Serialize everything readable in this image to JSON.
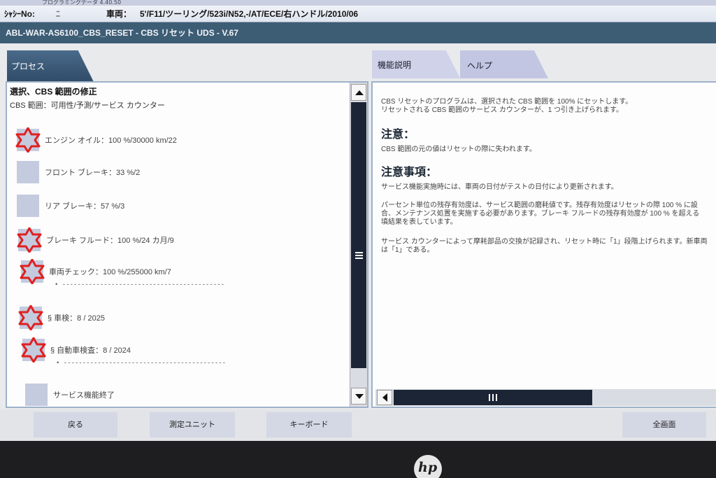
{
  "top_strip": "プログラミングデータ 4.40.50",
  "vehicle_bar": {
    "chassis_label": "ｼｬｼｰNo:",
    "chassis_value": "ﾆ",
    "vehicle_label": "車両：",
    "vehicle_value": "5'/F11/ツーリング/523i/N52,-/AT/ECE/右ハンドル/2010/06"
  },
  "window_title": "ABL-WAR-AS6100_CBS_RESET - CBS リセット UDS - V.67",
  "tabs": {
    "process": "プロセス",
    "function_desc": "機能説明",
    "help": "ヘルプ"
  },
  "left_panel": {
    "heading": "選択、CBS 範囲の修正",
    "subheading": "CBS 範囲：可用性/予測/サービス カウンター",
    "items": [
      {
        "label": "エンジン オイル：100 %/30000 km/22",
        "icon": "red-star-icon",
        "selected": true
      },
      {
        "label": "フロント ブレーキ：33 %/2",
        "icon": "grey-square-icon",
        "selected": false
      },
      {
        "label": "リア ブレーキ：57 %/3",
        "icon": "grey-square-icon",
        "selected": false
      },
      {
        "label": "ブレーキ フルード：100 %/24 カ月/9",
        "icon": "red-star-icon",
        "selected": true
      },
      {
        "label": "車両チェック：100 %/255000 km/7",
        "icon": "red-star-icon",
        "selected": true,
        "sub": "• -------------------------------------------"
      },
      {
        "label": "§ 車検：8 / 2025",
        "icon": "red-star-icon",
        "selected": true
      },
      {
        "label": "§ 自動車検査：8 / 2024",
        "icon": "red-star-icon",
        "selected": true,
        "sub": "• -------------------------------------------"
      },
      {
        "label": "サービス機能終了",
        "icon": "grey-square-icon",
        "selected": false
      }
    ]
  },
  "right_panel": {
    "intro_1": "CBS リセットのプログラムは、選択された CBS 範囲を 100% にセットします。",
    "intro_2": "リセットされる CBS 範囲のサービス カウンターが、1 つ引き上げられます。",
    "caution_head": "注意：",
    "caution_text": "CBS 範囲の元の値はリセットの際に失われます。",
    "notes_head": "注意事項：",
    "note_1": "サービス機能実施時には、車両の日付がテストの日付により更新されます。",
    "note_2a": "パーセント単位の残存有効度は、サービス範囲の磨耗値です。残存有効度はリセットの際 100 % に設",
    "note_2b": "合、メンテナンス処置を実施する必要があります。ブレーキ フルードの残存有効度が 100 % を超える",
    "note_2c": "填結果を表しています。",
    "note_3a": "サービス カウンターによって摩耗部品の交換が記録され、リセット時に「1」段階上げられます。新車両",
    "note_3b": "は「1」である。"
  },
  "bottom_bar": {
    "back": "戻る",
    "measure_unit": "測定ユニット",
    "keyboard": "キーボード",
    "fullscreen": "全画面"
  },
  "bezel_logo": "hp",
  "colors": {
    "title_bar": "#3d5d75",
    "selection_star": "#e02020",
    "scrollbar": "#1b2536",
    "tab_active": "#2f4c68",
    "tab_inactive": "#cfd2e8"
  }
}
